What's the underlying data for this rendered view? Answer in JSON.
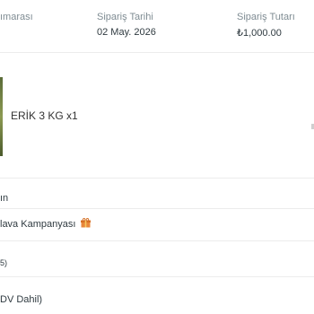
{
  "order": {
    "number_label": "ımarası",
    "date_label": "Sipariş Tarihi",
    "date_value": "02 May. 2026",
    "total_label": "Sipariş Tutarı",
    "total_value": "₺1,000.00"
  },
  "product": {
    "name": "ERİK 3 KG x1"
  },
  "rows": {
    "row1": "ın",
    "campaign": "lava Kampanyası",
    "row3": "5)",
    "row4": "DV Dahil)"
  },
  "icons": {
    "gift": "gift-icon"
  },
  "colors": {
    "label": "#7f8c93",
    "value": "#2f3a40",
    "gift": "#e8873a"
  }
}
